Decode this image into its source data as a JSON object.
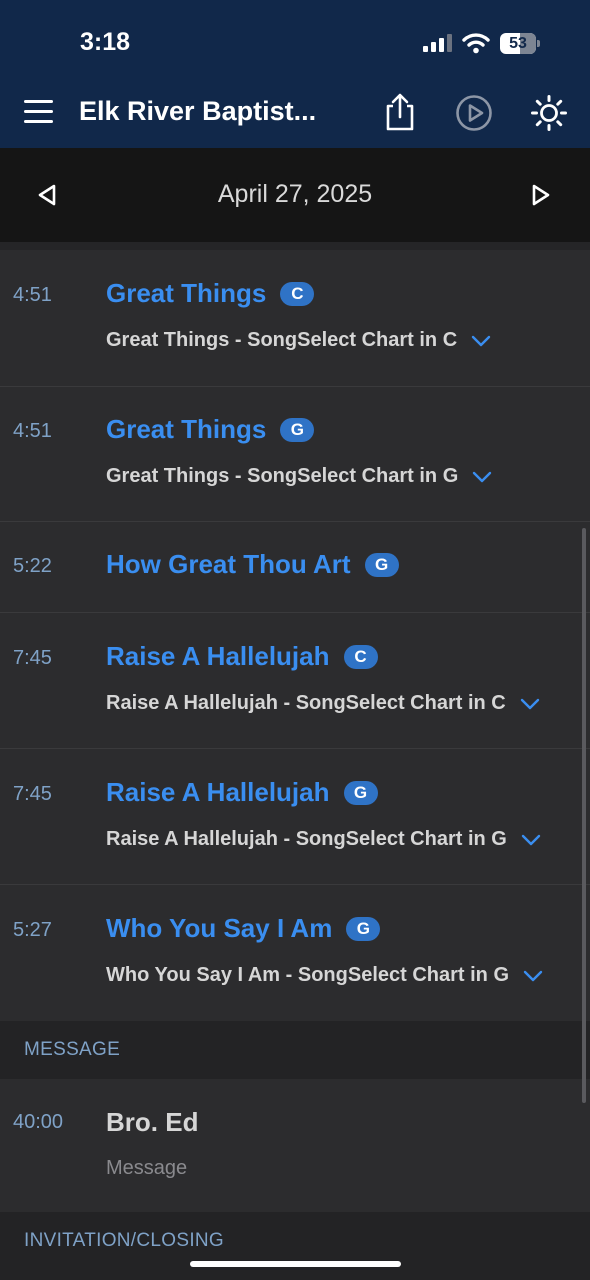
{
  "status_bar": {
    "time": "3:18",
    "battery": "53"
  },
  "header": {
    "title": "Elk River Baptist..."
  },
  "date_nav": {
    "date": "April 27, 2025"
  },
  "items": [
    {
      "time": "4:51",
      "title": "Great Things",
      "key": "C",
      "detail": "Great Things - SongSelect Chart in C"
    },
    {
      "time": "4:51",
      "title": "Great Things",
      "key": "G",
      "detail": "Great Things - SongSelect Chart in G"
    },
    {
      "time": "5:22",
      "title": "How Great Thou Art",
      "key": "G"
    },
    {
      "time": "7:45",
      "title": "Raise A Hallelujah",
      "key": "C",
      "detail": "Raise A Hallelujah - SongSelect Chart in C"
    },
    {
      "time": "7:45",
      "title": "Raise A Hallelujah",
      "key": "G",
      "detail": "Raise A Hallelujah - SongSelect Chart in G"
    },
    {
      "time": "5:27",
      "title": "Who You Say I Am",
      "key": "G",
      "detail": "Who You Say I Am - SongSelect Chart in G"
    }
  ],
  "sections": {
    "message": "MESSAGE",
    "invitation": "INVITATION/CLOSING"
  },
  "message_item": {
    "time": "40:00",
    "person": "Bro. Ed",
    "role": "Message"
  },
  "colors": {
    "header_bg": "#11284a",
    "accent": "#3a8ef0",
    "key_badge": "#2f73c6",
    "time_text": "#7fa2c7"
  }
}
